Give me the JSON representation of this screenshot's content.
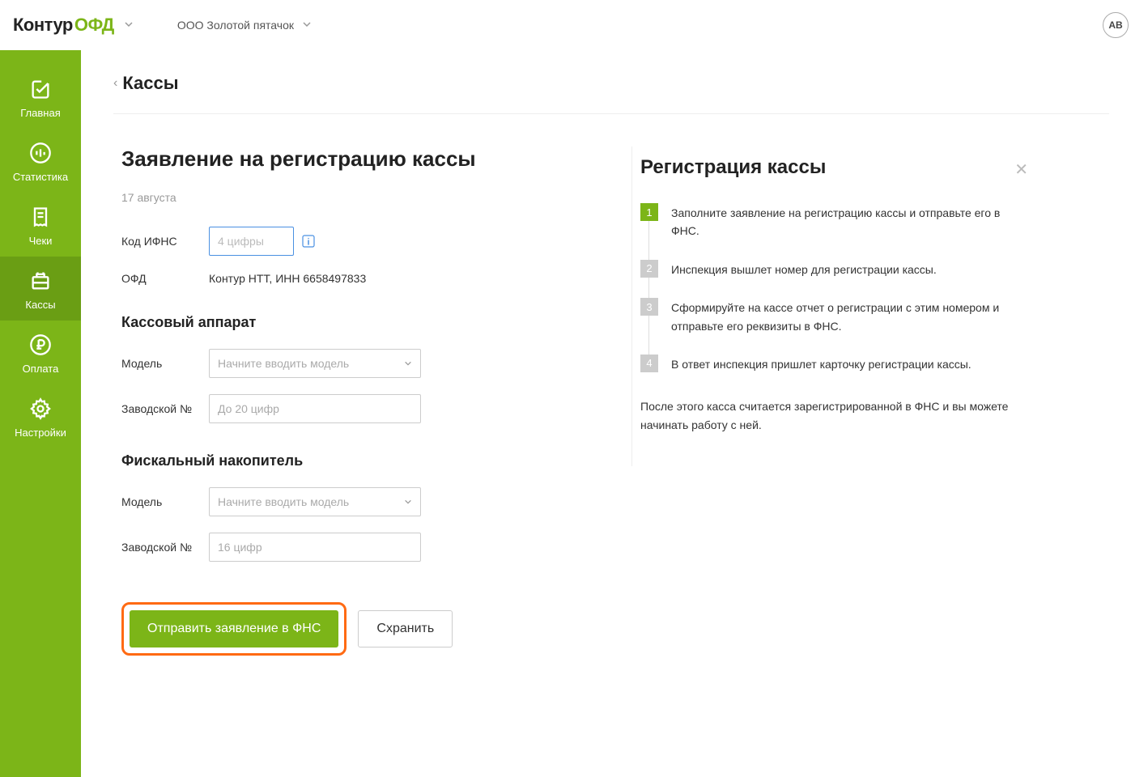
{
  "header": {
    "logo_kontur": "Контур",
    "logo_ofd": "ОФД",
    "company": "ООО Золотой пятачок",
    "avatar": "АВ"
  },
  "sidebar": {
    "items": [
      {
        "label": "Главная"
      },
      {
        "label": "Статистика"
      },
      {
        "label": "Чеки"
      },
      {
        "label": "Кассы"
      },
      {
        "label": "Оплата"
      },
      {
        "label": "Настройки"
      }
    ]
  },
  "breadcrumb": {
    "title": "Кассы"
  },
  "form": {
    "title": "Заявление на регистрацию кассы",
    "date": "17 августа",
    "ifns_label": "Код ИФНС",
    "ifns_placeholder": "4 цифры",
    "ofd_label": "ОФД",
    "ofd_value": "Контур НТТ, ИНН 6658497833",
    "section_kassa": "Кассовый аппарат",
    "section_fiscal": "Фискальный накопитель",
    "model_label": "Модель",
    "model_placeholder": "Начните вводить модель",
    "serial_label": "Заводской №",
    "serial_placeholder_kassa": "До 20 цифр",
    "serial_placeholder_fiscal": "16 цифр",
    "submit": "Отправить заявление в ФНС",
    "save": "Схранить"
  },
  "info": {
    "title": "Регистрация кассы",
    "steps": [
      "Заполните заявление на регистрацию кассы и отправьте его в ФНС.",
      "Инспекция вышлет номер для регистрации кассы.",
      "Сформируйте на кассе отчет о регистрации с этим номером и отправьте его реквизиты в ФНС.",
      "В ответ инспекция пришлет карточку регистрации кассы."
    ],
    "footer": "После этого касса считается зарегистрированной в ФНС и вы можете начинать работу с ней."
  }
}
